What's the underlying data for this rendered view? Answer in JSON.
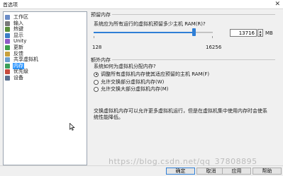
{
  "window": {
    "title": "首选项",
    "close_glyph": "✕"
  },
  "nav": {
    "items": [
      {
        "label": "工作区",
        "icon": "workspace-icon",
        "color": "#6b8cc7"
      },
      {
        "label": "输入",
        "icon": "keyboard-icon",
        "color": "#7a7a7a"
      },
      {
        "label": "热键",
        "icon": "hotkey-icon",
        "color": "#5a8f3c"
      },
      {
        "label": "显示",
        "icon": "monitor-icon",
        "color": "#3c7fc7"
      },
      {
        "label": "Unity",
        "icon": "unity-icon",
        "color": "#8f5ac7"
      },
      {
        "label": "更新",
        "icon": "update-icon",
        "color": "#3ca04c"
      },
      {
        "label": "反馈",
        "icon": "feedback-icon",
        "color": "#c7a03c"
      },
      {
        "label": "共享虚拟机",
        "icon": "shared-vm-icon",
        "color": "#6a9fcf"
      },
      {
        "label": "内存",
        "icon": "memory-icon",
        "color": "#3c9f5a",
        "selected": true
      },
      {
        "label": "优先级",
        "icon": "priority-icon",
        "color": "#c74a3c"
      },
      {
        "label": "设备",
        "icon": "device-icon",
        "color": "#5a6f8f"
      }
    ]
  },
  "reserved": {
    "title": "预留内存",
    "prompt": "系统应为所有运行的虚拟机预留多少主机 RAM(R)?",
    "min_label": "128",
    "max_label": "16256",
    "value": "13716",
    "unit": "MB",
    "fraction": 0.84
  },
  "extra": {
    "title": "额外内存",
    "question": "系统如何为虚拟机分配内存?",
    "options": [
      {
        "label": "调整所有虚拟机内存使其适应预留的主机 RAM(F)",
        "checked": true
      },
      {
        "label": "允许交换部分虚拟机内存(W)",
        "checked": false
      },
      {
        "label": "允许交换大部分虚拟机内存(M)",
        "checked": false
      }
    ],
    "description": "交换虚拟机内存可以允许更多虚拟机运行，但是在虚拟机集中使用内存时会使系统性能降低。"
  },
  "buttons": {
    "ok": "确定",
    "cancel": "取消",
    "apply": "应用",
    "help": "帮助"
  },
  "watermark": "https://blog.csdn.net/qq_37808895"
}
